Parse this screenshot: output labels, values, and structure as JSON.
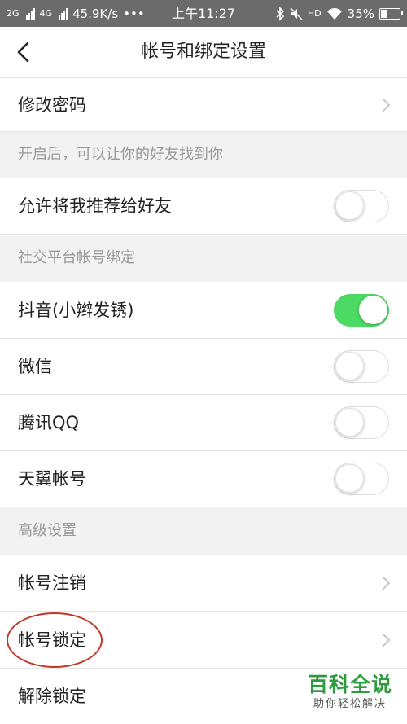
{
  "status_bar": {
    "network_2g": "2G",
    "network_4g": "4G",
    "speed": "45.9K/s",
    "more": "•••",
    "time": "上午11:27",
    "hd": "HD",
    "battery": "35%",
    "battery_level": 0.35
  },
  "header": {
    "title": "帐号和绑定设置"
  },
  "rows": {
    "change_password": "修改密码",
    "friend_section_hint": "开启后，可以让你的好友找到你",
    "recommend_to_friends": "允许将我推荐给好友",
    "social_section": "社交平台帐号绑定",
    "douyin": "抖音(小辫发锈)",
    "wechat": "微信",
    "qq": "腾讯QQ",
    "tianyi": "天翼帐号",
    "advanced_section": "高级设置",
    "account_cancel": "帐号注销",
    "account_lock": "帐号锁定",
    "unlock": "解除锁定"
  },
  "toggles": {
    "recommend_to_friends": false,
    "douyin": true,
    "wechat": false,
    "qq": false,
    "tianyi": false
  },
  "watermark": {
    "main": "百科全说",
    "sub": "助你轻松解决"
  },
  "colors": {
    "toggle_on": "#4cd964",
    "annotation_circle": "#c0392b",
    "watermark_green": "#2e9b3e"
  }
}
